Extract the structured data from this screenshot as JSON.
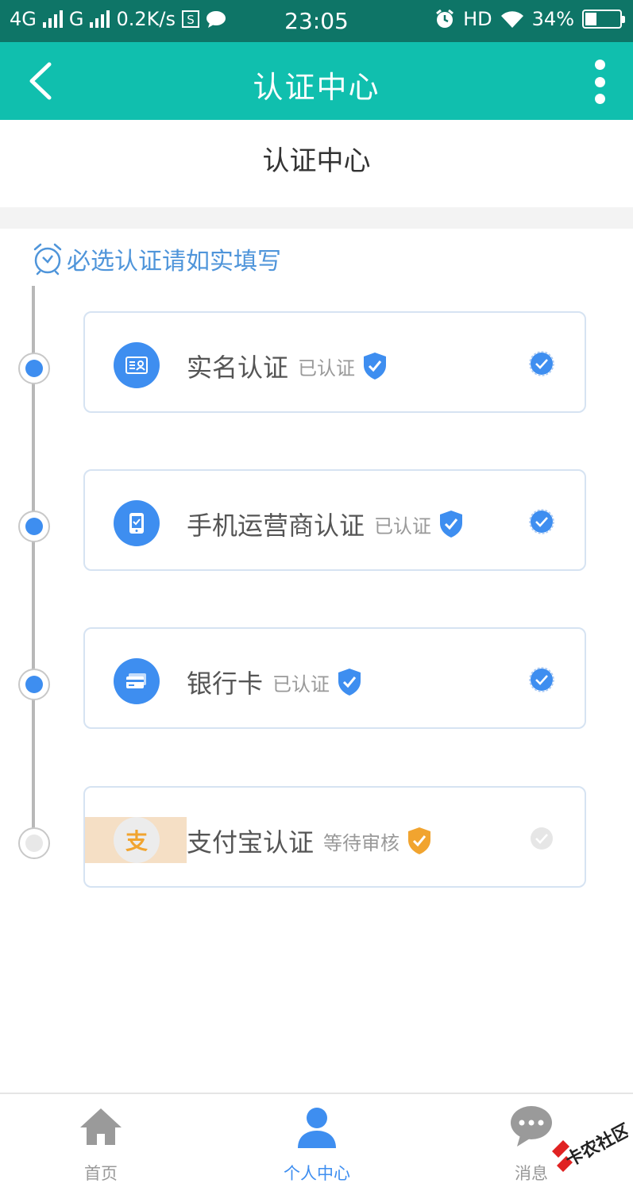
{
  "status_bar": {
    "network_1": "4G",
    "network_2": "G",
    "speed": "0.2K/s",
    "time": "23:05",
    "hd": "HD",
    "battery": "34%",
    "battery_level": 0.34
  },
  "app_bar": {
    "title": "认证中心"
  },
  "page": {
    "section_title": "认证中心",
    "required_note": "必选认证请如实填写"
  },
  "colors": {
    "accent": "#10bfae",
    "status_bar": "#0e7567",
    "primary_blue": "#3e8ef0",
    "warning_orange": "#f1a42f"
  },
  "verifications": [
    {
      "name": "实名认证",
      "status": "已认证",
      "icon": "id-card-icon",
      "state": "verified"
    },
    {
      "name": "手机运营商认证",
      "status": "已认证",
      "icon": "phone-icon",
      "state": "verified"
    },
    {
      "name": "银行卡",
      "status": "已认证",
      "icon": "bank-card-icon",
      "state": "verified"
    },
    {
      "name": "支付宝认证",
      "status": "等待审核",
      "icon": "alipay-icon",
      "state": "pending",
      "alipay_glyph": "支"
    }
  ],
  "bottom_nav": {
    "items": [
      {
        "label": "首页",
        "icon": "home-icon"
      },
      {
        "label": "个人中心",
        "icon": "person-icon",
        "active": true
      },
      {
        "label": "消息",
        "icon": "message-icon"
      }
    ]
  },
  "watermark": {
    "text": "卡农社区"
  }
}
